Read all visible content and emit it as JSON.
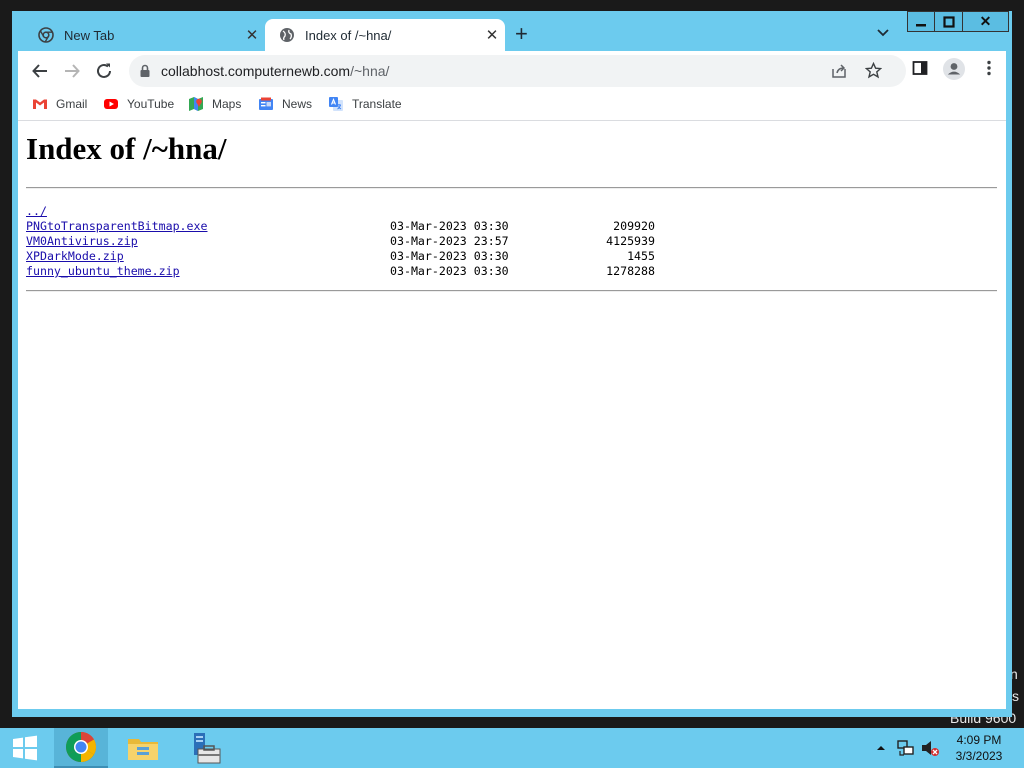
{
  "desktop": {
    "partial_text_1": "n",
    "partial_text_2": "s",
    "build_text": "Build 9600"
  },
  "tabs": [
    {
      "label": "New Tab",
      "icon": "chrome-icon",
      "active": false
    },
    {
      "label": "Index of /~hna/",
      "icon": "globe-icon",
      "active": true
    }
  ],
  "window_controls": {
    "close": "✕"
  },
  "omnibox": {
    "host": "collabhost.computernewb.com",
    "path": "/~hna/"
  },
  "bookmarks": [
    {
      "label": "Gmail",
      "icon": "gmail-icon"
    },
    {
      "label": "YouTube",
      "icon": "youtube-icon"
    },
    {
      "label": "Maps",
      "icon": "maps-icon"
    },
    {
      "label": "News",
      "icon": "news-icon"
    },
    {
      "label": "Translate",
      "icon": "translate-icon"
    }
  ],
  "page": {
    "heading": "Index of /~hna/",
    "parent_link": "../",
    "files": [
      {
        "name": "PNGtoTransparentBitmap.exe",
        "date": "03-Mar-2023 03:30",
        "size": "209920"
      },
      {
        "name": "VM0Antivirus.zip",
        "date": "03-Mar-2023 23:57",
        "size": "4125939"
      },
      {
        "name": "XPDarkMode.zip",
        "date": "03-Mar-2023 03:30",
        "size": "1455"
      },
      {
        "name": "funny_ubuntu_theme.zip",
        "date": "03-Mar-2023 03:30",
        "size": "1278288"
      }
    ]
  },
  "taskbar": {
    "clock_time": "4:09 PM",
    "clock_date": "3/3/2023"
  },
  "colors": {
    "window_frame": "#6ccbee",
    "link": "#1a0dab",
    "taskbar": "#6ccbee"
  }
}
